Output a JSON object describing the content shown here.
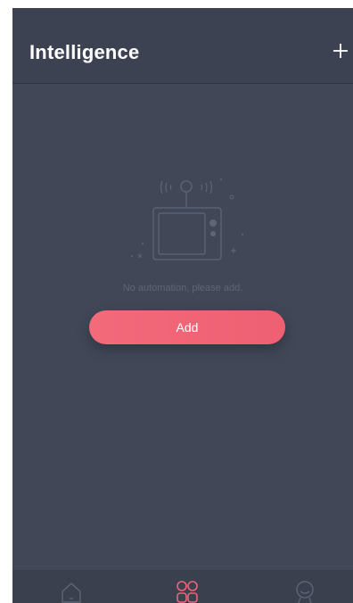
{
  "header": {
    "title": "Intelligence"
  },
  "empty_state": {
    "message": "No automation, please add.",
    "icon": "tv-antenna-illustration"
  },
  "actions": {
    "add_label": "Add"
  },
  "tabbar": {
    "tabs": [
      {
        "name": "home",
        "icon": "home-icon",
        "active": false
      },
      {
        "name": "intelligence",
        "icon": "grid-icon",
        "active": true
      },
      {
        "name": "profile",
        "icon": "profile-icon",
        "active": false
      }
    ]
  },
  "colors": {
    "background": "#414757",
    "header": "#3c4251",
    "accent": "#f0647a",
    "muted_text": "#5d6577"
  }
}
